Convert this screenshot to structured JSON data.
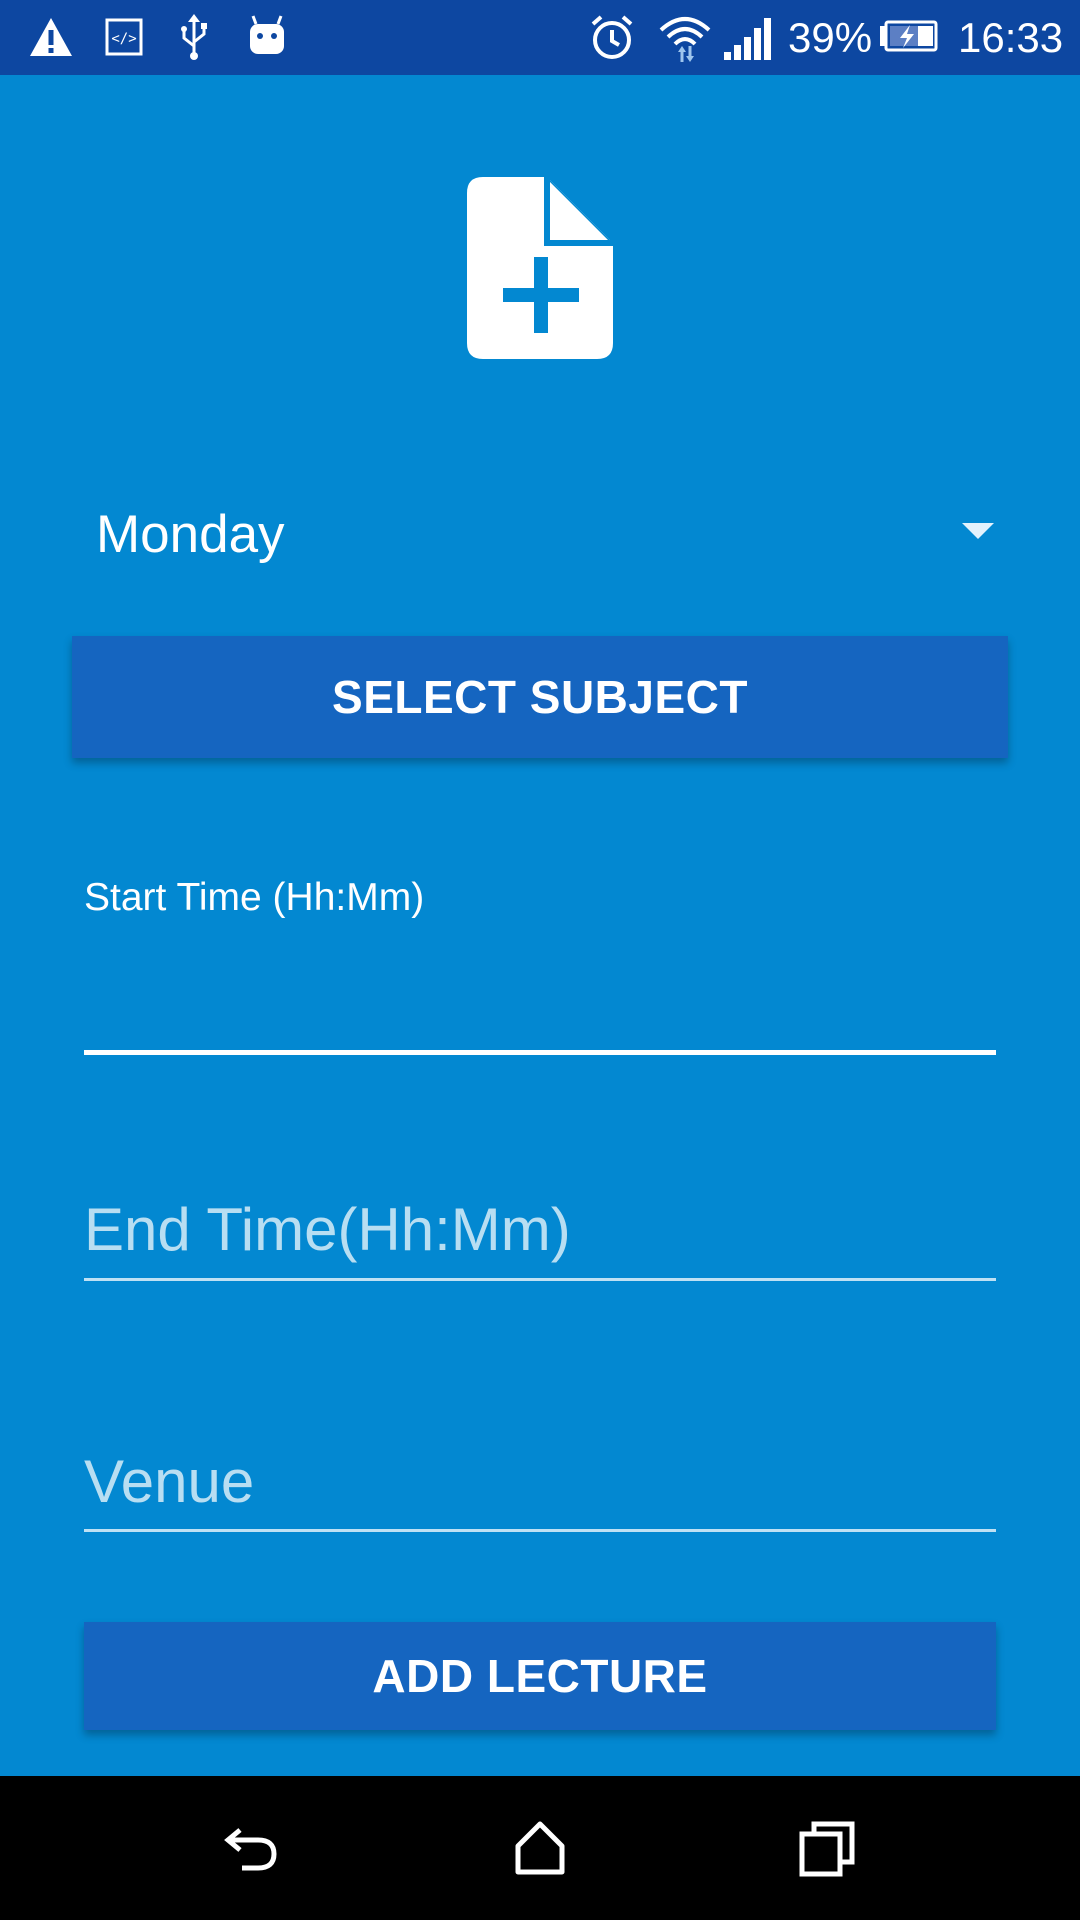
{
  "status_bar": {
    "icons": [
      "warning-icon",
      "code-icon",
      "usb-icon",
      "android-debug-icon",
      "alarm-icon",
      "wifi-icon",
      "signal-icon",
      "battery-charging-icon"
    ],
    "battery_percent": "39%",
    "time": "16:33"
  },
  "header_icon": "note-add-icon",
  "day_spinner": {
    "selected": "Monday"
  },
  "select_subject_button": {
    "label": "SELECT SUBJECT"
  },
  "start_time": {
    "label": "Start Time (Hh:Mm)",
    "value": ""
  },
  "end_time": {
    "placeholder": "End Time(Hh:Mm)",
    "value": ""
  },
  "venue": {
    "placeholder": "Venue",
    "value": ""
  },
  "add_lecture_button": {
    "label": "ADD LECTURE"
  },
  "nav_bar": {
    "buttons": [
      "back-icon",
      "home-icon",
      "recents-icon"
    ]
  },
  "colors": {
    "background": "#0388d1",
    "status_bar": "#0d47a1",
    "button": "#1565c0",
    "nav_bar": "#000000"
  }
}
